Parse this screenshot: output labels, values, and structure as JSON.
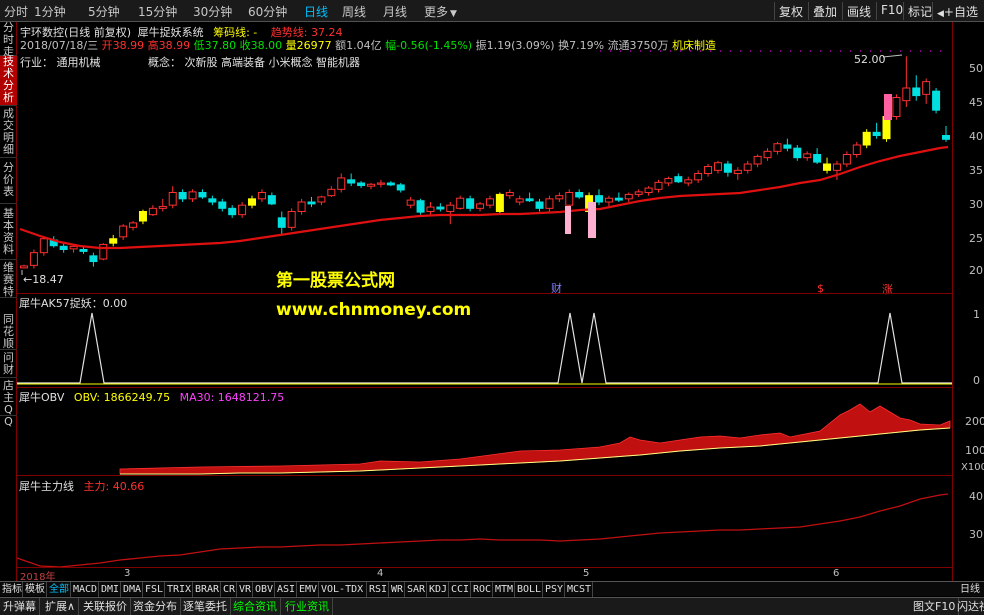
{
  "toolbar": {
    "periods": [
      "分时",
      "1分钟",
      "5分钟",
      "15分钟",
      "30分钟",
      "60分钟",
      "日线",
      "周线",
      "月线",
      "更多"
    ],
    "active_period": "日线",
    "more_arrow": "▼",
    "tools": [
      "复权",
      "叠加",
      "画线",
      "F10",
      "标记",
      "+自选"
    ],
    "nav_arrow": "◀"
  },
  "left_tabs": [
    "分时走势",
    "技术分析",
    "成交明细",
    "分价表",
    "基本资料",
    "维赛特"
  ],
  "left_tabs_lower": [
    "同花顺",
    "问财",
    "店主QQ"
  ],
  "header": {
    "stock": "宇环数控(日线 前复权)",
    "system": "犀牛捉妖系统",
    "chip_label": "筹码线: -",
    "trend_label": "趋势线: 37.24",
    "date": "2018/07/18/三",
    "open": "开38.99",
    "high": "高38.99",
    "low": "低37.80",
    "close": "收38.00",
    "vol": "量26977",
    "amount": "额1.04亿",
    "change": "幅-0.56(-1.45%)",
    "amplitude": "振1.19(3.09%)",
    "turnover": "换7.19%",
    "float": "流通3750万",
    "industry_tag": "机床制造",
    "industry": "行业：  通用机械",
    "concept": "概念：  次新股 高端装备 小米概念 智能机器"
  },
  "price_axis": [
    "50",
    "45",
    "40",
    "35",
    "30",
    "25",
    "20"
  ],
  "low_marker": "←18.47",
  "high_marker": "52.00",
  "watermark": {
    "line1": "第一股票公式网",
    "line2": "www.chnmoney.com"
  },
  "markers": {
    "cai": "财",
    "s": "$",
    "zhang": "涨"
  },
  "panel1": {
    "label": "犀牛AK57捉妖：0.00",
    "ticks": [
      "1",
      "0"
    ]
  },
  "panel2": {
    "label": "犀牛OBV",
    "obv": "OBV: 1866249.75",
    "ma": "MA30: 1648121.75",
    "ticks": [
      "200",
      "100"
    ],
    "unit": "X100"
  },
  "panel3": {
    "label": "犀牛主力线",
    "value": "主力: 40.66",
    "ticks": [
      "40",
      "30"
    ]
  },
  "date_axis": [
    "2018年",
    "3",
    "4",
    "5",
    "6"
  ],
  "indicator_tabs": [
    "指标",
    "模板",
    "全部",
    "MACD",
    "DMI",
    "DMA",
    "FSL",
    "TRIX",
    "BRAR",
    "CR",
    "VR",
    "OBV",
    "ASI",
    "EMV",
    "VOL-TDX",
    "RSI",
    "WR",
    "SAR",
    "KDJ",
    "CCI",
    "ROC",
    "MTM",
    "BOLL",
    "PSY",
    "MCST"
  ],
  "active_indicator": "全部",
  "daily_label": "日线",
  "bottom_tabs": [
    "升弹幕",
    "扩展∧",
    "关联报价",
    "资金分布",
    "逐笔委托",
    "综合资讯",
    "行业资讯"
  ],
  "bottom_right": [
    "图文F10",
    "闪达社"
  ],
  "colors": {
    "up": "#ff3030",
    "down": "#00e0e0",
    "signal": "#ffff00",
    "trend": "#e01010",
    "accent": "#00c0ff"
  },
  "chart_data": {
    "type": "candlestick",
    "ylim": [
      17,
      53
    ],
    "x": [
      1,
      2,
      3,
      4,
      5,
      6,
      7,
      8,
      9,
      10,
      11,
      12,
      13,
      14,
      15,
      16,
      17,
      18,
      19,
      20,
      21,
      22,
      23,
      24,
      25,
      26,
      27,
      28,
      29,
      30,
      31,
      32,
      33,
      34,
      35,
      36,
      37,
      38,
      39,
      40,
      41,
      42,
      43,
      44,
      45,
      46,
      47,
      48,
      49,
      50,
      51,
      52,
      53,
      54,
      55,
      56,
      57,
      58,
      59,
      60,
      61,
      62,
      63,
      64,
      65,
      66,
      67,
      68,
      69,
      70,
      71,
      72,
      73,
      74,
      75,
      76,
      77,
      78,
      79,
      80,
      81,
      82,
      83,
      84,
      85,
      86,
      87,
      88,
      89,
      90,
      91,
      92,
      93,
      94
    ],
    "candles": [
      [
        18.6,
        19.1,
        18.5,
        18.9
      ],
      [
        19.0,
        21.5,
        18.5,
        21.0
      ],
      [
        21.0,
        23.6,
        20.5,
        23.2
      ],
      [
        23.0,
        23.6,
        21.8,
        22.1
      ],
      [
        22.0,
        22.4,
        21.0,
        21.5
      ],
      [
        21.6,
        22.3,
        21.0,
        22.0
      ],
      [
        21.5,
        22.0,
        20.8,
        21.2
      ],
      [
        20.5,
        21.0,
        18.8,
        19.6
      ],
      [
        20.0,
        22.5,
        19.8,
        22.3
      ],
      [
        22.5,
        23.8,
        22.0,
        23.2
      ],
      [
        23.5,
        25.5,
        23.0,
        25.2
      ],
      [
        25.0,
        26.0,
        24.5,
        25.7
      ],
      [
        26.0,
        27.8,
        25.5,
        27.5
      ],
      [
        27.0,
        28.5,
        26.8,
        28.0
      ],
      [
        28.0,
        29.5,
        27.5,
        28.3
      ],
      [
        28.5,
        31.5,
        28.0,
        30.5
      ],
      [
        30.5,
        31.0,
        29.0,
        29.5
      ],
      [
        29.5,
        31.0,
        29.0,
        30.6
      ],
      [
        30.5,
        31.0,
        29.5,
        29.8
      ],
      [
        29.5,
        30.0,
        28.5,
        29.0
      ],
      [
        29.0,
        29.5,
        27.5,
        28.0
      ],
      [
        28.0,
        28.5,
        26.5,
        27.0
      ],
      [
        27.0,
        29.0,
        26.5,
        28.5
      ],
      [
        28.5,
        30.0,
        28.0,
        29.5
      ],
      [
        29.5,
        31.0,
        29.0,
        30.5
      ],
      [
        30.0,
        30.5,
        28.5,
        28.7
      ],
      [
        26.5,
        27.5,
        24.0,
        25.0
      ],
      [
        25.0,
        28.0,
        24.5,
        27.5
      ],
      [
        27.5,
        29.5,
        27.0,
        29.0
      ],
      [
        29.0,
        29.8,
        28.2,
        28.7
      ],
      [
        29.0,
        30.0,
        28.5,
        29.8
      ],
      [
        30.0,
        31.5,
        29.8,
        31.0
      ],
      [
        31.0,
        33.5,
        30.5,
        32.8
      ],
      [
        32.5,
        33.5,
        31.5,
        32.0
      ],
      [
        32.0,
        32.3,
        31.2,
        31.6
      ],
      [
        31.5,
        32.0,
        31.0,
        31.8
      ],
      [
        31.8,
        32.5,
        31.3,
        32.0
      ],
      [
        32.0,
        32.3,
        31.5,
        31.7
      ],
      [
        31.7,
        32.0,
        30.5,
        30.9
      ],
      [
        28.5,
        29.8,
        28.0,
        29.3
      ],
      [
        29.2,
        29.5,
        27.0,
        27.4
      ],
      [
        27.5,
        29.0,
        27.0,
        28.2
      ],
      [
        28.2,
        28.8,
        27.5,
        27.9
      ],
      [
        27.5,
        29.0,
        25.5,
        28.5
      ],
      [
        28.0,
        30.0,
        27.8,
        29.6
      ],
      [
        29.5,
        30.0,
        27.5,
        28.0
      ],
      [
        28.0,
        29.0,
        27.5,
        28.7
      ],
      [
        28.5,
        30.0,
        28.0,
        29.5
      ],
      [
        27.5,
        30.5,
        27.0,
        30.2
      ],
      [
        30.0,
        31.0,
        29.5,
        30.5
      ],
      [
        29.0,
        30.0,
        28.5,
        29.5
      ],
      [
        29.5,
        30.5,
        29.0,
        29.2
      ],
      [
        29.0,
        29.5,
        27.5,
        28.0
      ],
      [
        28.0,
        30.0,
        27.5,
        29.5
      ],
      [
        29.5,
        30.5,
        29.0,
        30.0
      ],
      [
        28.5,
        31.0,
        28.0,
        30.5
      ],
      [
        30.5,
        31.0,
        29.5,
        29.8
      ],
      [
        27.5,
        30.5,
        27.0,
        30.0
      ],
      [
        30.0,
        31.0,
        28.5,
        29.0
      ],
      [
        29.0,
        30.0,
        28.0,
        29.6
      ],
      [
        29.6,
        30.5,
        29.0,
        29.3
      ],
      [
        29.5,
        30.5,
        29.0,
        30.2
      ],
      [
        30.2,
        31.0,
        29.8,
        30.6
      ],
      [
        30.5,
        31.5,
        30.0,
        31.2
      ],
      [
        31.0,
        32.5,
        30.5,
        32.1
      ],
      [
        32.0,
        33.0,
        31.5,
        32.7
      ],
      [
        33.0,
        33.5,
        32.0,
        32.2
      ],
      [
        32.0,
        33.0,
        31.5,
        32.5
      ],
      [
        32.5,
        34.0,
        32.0,
        33.5
      ],
      [
        33.5,
        35.0,
        33.0,
        34.6
      ],
      [
        34.0,
        35.5,
        33.5,
        35.2
      ],
      [
        35.0,
        35.5,
        33.0,
        33.7
      ],
      [
        33.5,
        34.5,
        32.5,
        34.0
      ],
      [
        34.0,
        35.5,
        33.5,
        35.0
      ],
      [
        35.0,
        36.5,
        34.5,
        36.2
      ],
      [
        36.0,
        37.5,
        35.5,
        37.0
      ],
      [
        37.0,
        38.5,
        36.5,
        38.2
      ],
      [
        38.0,
        39.0,
        37.0,
        37.5
      ],
      [
        37.5,
        38.0,
        35.5,
        36.0
      ],
      [
        36.0,
        37.0,
        35.5,
        36.6
      ],
      [
        36.5,
        37.5,
        35.0,
        35.3
      ],
      [
        35.0,
        36.0,
        33.5,
        34.0
      ],
      [
        34.0,
        35.5,
        32.5,
        35.0
      ],
      [
        35.0,
        37.0,
        34.5,
        36.5
      ],
      [
        36.5,
        38.5,
        36.0,
        38.0
      ],
      [
        38.0,
        40.5,
        37.5,
        40.0
      ],
      [
        40.0,
        41.5,
        39.0,
        39.5
      ],
      [
        39.0,
        43.0,
        38.5,
        42.5
      ],
      [
        42.5,
        46.0,
        42.0,
        45.5
      ],
      [
        45.0,
        52.0,
        44.0,
        47.0
      ],
      [
        47.0,
        49.0,
        45.0,
        45.8
      ],
      [
        46.0,
        48.5,
        44.5,
        48.0
      ],
      [
        46.5,
        47.0,
        43.0,
        43.5
      ],
      [
        39.5,
        41.0,
        38.5,
        38.9
      ]
    ]
  }
}
